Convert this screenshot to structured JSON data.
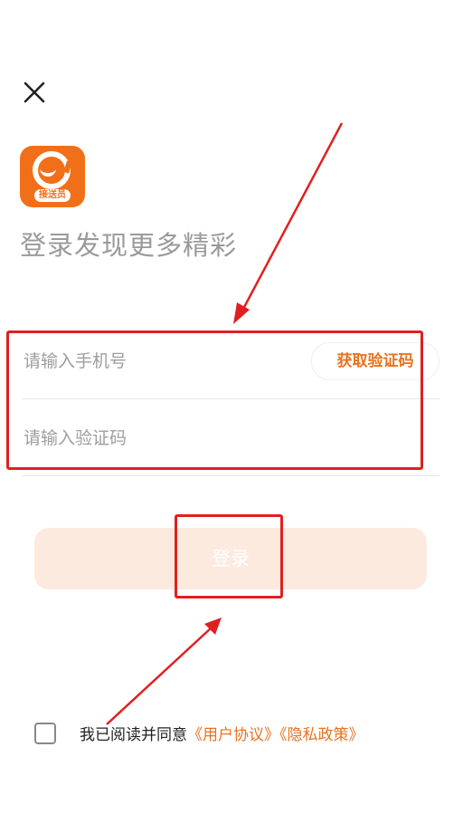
{
  "header": {
    "close_icon": "close-icon"
  },
  "logo": {
    "icon": "app-logo-icon",
    "badge_text": "接送员",
    "color": "#f26f1a"
  },
  "title": "登录发现更多精彩",
  "form": {
    "phone_placeholder": "请输入手机号",
    "code_placeholder": "请输入验证码",
    "get_code_label": "获取验证码",
    "login_label": "登录"
  },
  "agreement": {
    "prefix": "我已阅读并同意",
    "user_agreement": "《用户协议》",
    "privacy_policy": "《隐私政策》",
    "checked": false
  },
  "colors": {
    "accent": "#e9721e",
    "login_button_bg": "#fdeadf",
    "annotation_red": "#e02020"
  }
}
